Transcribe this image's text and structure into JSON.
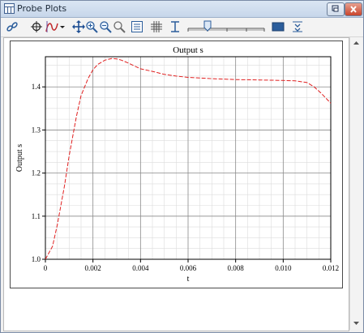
{
  "window": {
    "title": "Probe Plots"
  },
  "icons": {
    "window_icon": "grid-window-icon",
    "restore": "restore-icon",
    "close": "close-icon",
    "link": "link-icon",
    "target": "crosshair-target-icon",
    "probe": "probe-curve-icon",
    "pan": "pan-arrows-icon",
    "zoom_in": "zoom-in-icon",
    "zoom_out": "zoom-out-icon",
    "zoom_reset": "zoom-reset-icon",
    "legend": "legend-icon",
    "grid": "grid-icon",
    "cursor": "cursor-icon",
    "slider": "slider-icon",
    "fill": "fill-icon",
    "fit": "fit-vertical-icon"
  },
  "colors": {
    "series": "#e02020",
    "grid_major": "#8a8a8a",
    "grid_minor": "#dcdcdc"
  },
  "chart_data": {
    "type": "line",
    "title": "Output s",
    "xlabel": "t",
    "ylabel": "Output s",
    "xlim": [
      0,
      0.012
    ],
    "ylim": [
      1.0,
      1.47
    ],
    "x_ticks": [
      0,
      0.002,
      0.004,
      0.006,
      0.008,
      0.01,
      0.012
    ],
    "x_tick_labels": [
      "0",
      "0.002",
      "0.004",
      "0.006",
      "0.008",
      "0.010",
      "0.012"
    ],
    "y_ticks": [
      1.0,
      1.1,
      1.2,
      1.3,
      1.4
    ],
    "y_tick_labels": [
      "1.0",
      "1.1",
      "1.2",
      "1.3",
      "1.4"
    ],
    "grid": true,
    "series": [
      {
        "line_style": "dashed",
        "x": [
          0,
          0.0003,
          0.0005,
          0.0008,
          0.001,
          0.0013,
          0.0015,
          0.0018,
          0.002,
          0.0022,
          0.0025,
          0.0028,
          0.003,
          0.0032,
          0.0035,
          0.0038,
          0.004,
          0.0045,
          0.005,
          0.0055,
          0.006,
          0.007,
          0.008,
          0.009,
          0.01,
          0.0105,
          0.011,
          0.0113,
          0.0116,
          0.012
        ],
        "y": [
          1.0,
          1.03,
          1.08,
          1.17,
          1.24,
          1.33,
          1.38,
          1.42,
          1.44,
          1.452,
          1.462,
          1.466,
          1.465,
          1.462,
          1.455,
          1.447,
          1.442,
          1.436,
          1.429,
          1.425,
          1.422,
          1.419,
          1.417,
          1.416,
          1.415,
          1.414,
          1.41,
          1.4,
          1.385,
          1.362
        ]
      }
    ]
  }
}
